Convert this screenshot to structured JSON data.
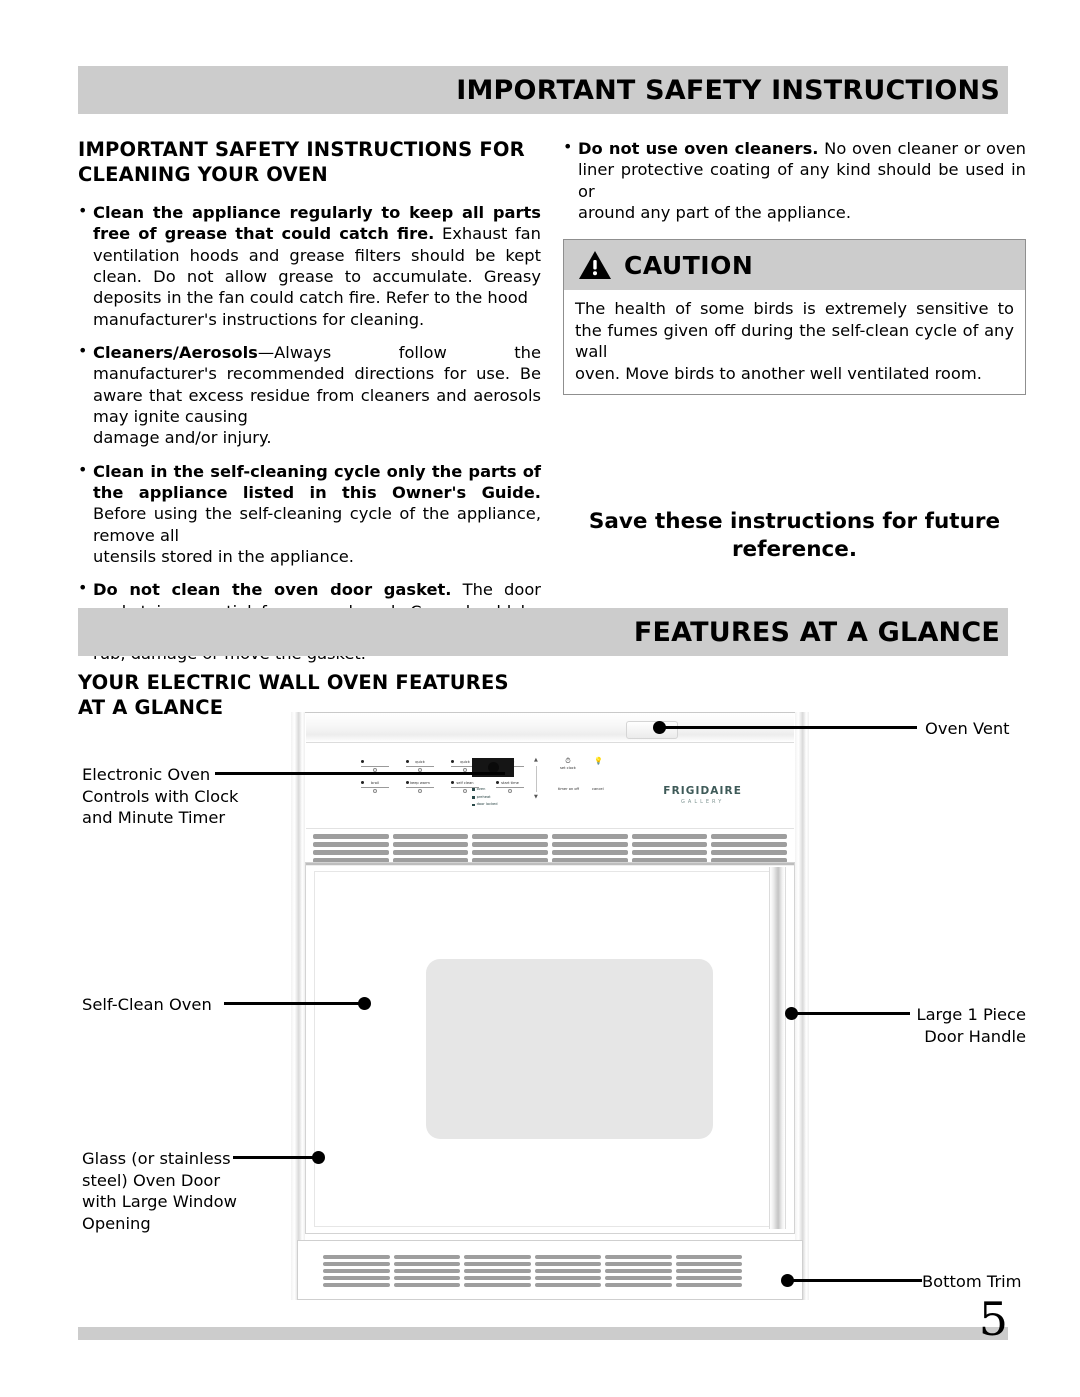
{
  "headers": {
    "top_bar": "IMPORTANT SAFETY INSTRUCTIONS",
    "features_bar": "FEATURES AT A GLANCE"
  },
  "left_column": {
    "heading": "IMPORTANT SAFETY INSTRUCTIONS FOR CLEANING YOUR OVEN",
    "bullets": [
      {
        "bold": "Clean the appliance regularly to keep all parts free of grease that could catch fire.",
        "text": " Exhaust fan ventilation hoods and  grease filters should be kept clean. Do not allow grease to accumulate. Greasy deposits in the fan could catch fire. Refer to the hood",
        "last_line": "manufacturer's instructions for cleaning."
      },
      {
        "bold": "Cleaners/Aerosols",
        "text": "—Always follow the manufacturer's recommended directions for use. Be aware that excess residue from cleaners and aerosols may ignite causing",
        "last_line": "damage and/or injury."
      },
      {
        "bold": "Clean in the self-cleaning cycle only the parts of the appliance listed in this Owner's Guide.",
        "text": " Before using the self-cleaning cycle of the appliance, remove all",
        "last_line": "utensils stored in the appliance."
      },
      {
        "bold": "Do not clean the oven door gasket.",
        "text": " The door gasket is essential for a good seal. Care should be taken not to",
        "last_line": "rub, damage or move the gasket."
      }
    ]
  },
  "right_column": {
    "bullets": [
      {
        "bold": "Do not use oven cleaners.",
        "text": " No oven cleaner or oven liner protective coating of any kind should be used in or",
        "last_line": "around any part of the appliance."
      }
    ],
    "caution": {
      "title": "CAUTION",
      "body": "The health of some birds is extremely sensitive to the fumes given off during the self-clean cycle of any wall",
      "body_last_line": "oven. Move birds to another well ventilated room.",
      "header_bg": "#cccccc"
    },
    "save_note_line1": "Save these instructions for future",
    "save_note_line2": "reference."
  },
  "features": {
    "heading_line1": "YOUR ELECTRIC WALL OVEN FEATURES",
    "heading_line2": "AT A GLANCE",
    "callouts": {
      "electronic_controls": "Electronic Oven\nControls with Clock\nand Minute Timer",
      "electronic_controls_lines": [
        "Electronic Oven",
        "Controls with Clock",
        "and Minute Timer"
      ],
      "self_clean": "Self-Clean Oven",
      "glass_door_lines": [
        "Glass (or stainless",
        "steel) Oven Door",
        "with Large Window",
        "Opening"
      ],
      "oven_vent": "Oven Vent",
      "door_handle_lines": [
        "Large 1 Piece",
        "Door Handle"
      ],
      "bottom_trim": "Bottom Trim"
    },
    "appliance": {
      "brand": "FRIGIDAIRE",
      "brand_sub": "GALLERY",
      "keys_row1": [
        "quick",
        "quick",
        "bake"
      ],
      "keys_row1_full": [
        "",
        "quick\nbroil",
        "quick\nbake",
        "bake"
      ],
      "keys_row2": [
        "broil",
        "keep warm",
        "self clean",
        "start time"
      ],
      "status_indicators": [
        "oven",
        "preheat",
        "door locked"
      ],
      "function_keys": [
        "set clock",
        "timer on off",
        "cancel"
      ],
      "light_icon": "light-bulb-icon",
      "cancel_indicator_color": "#f0a52a"
    }
  },
  "page": {
    "number": "5"
  }
}
